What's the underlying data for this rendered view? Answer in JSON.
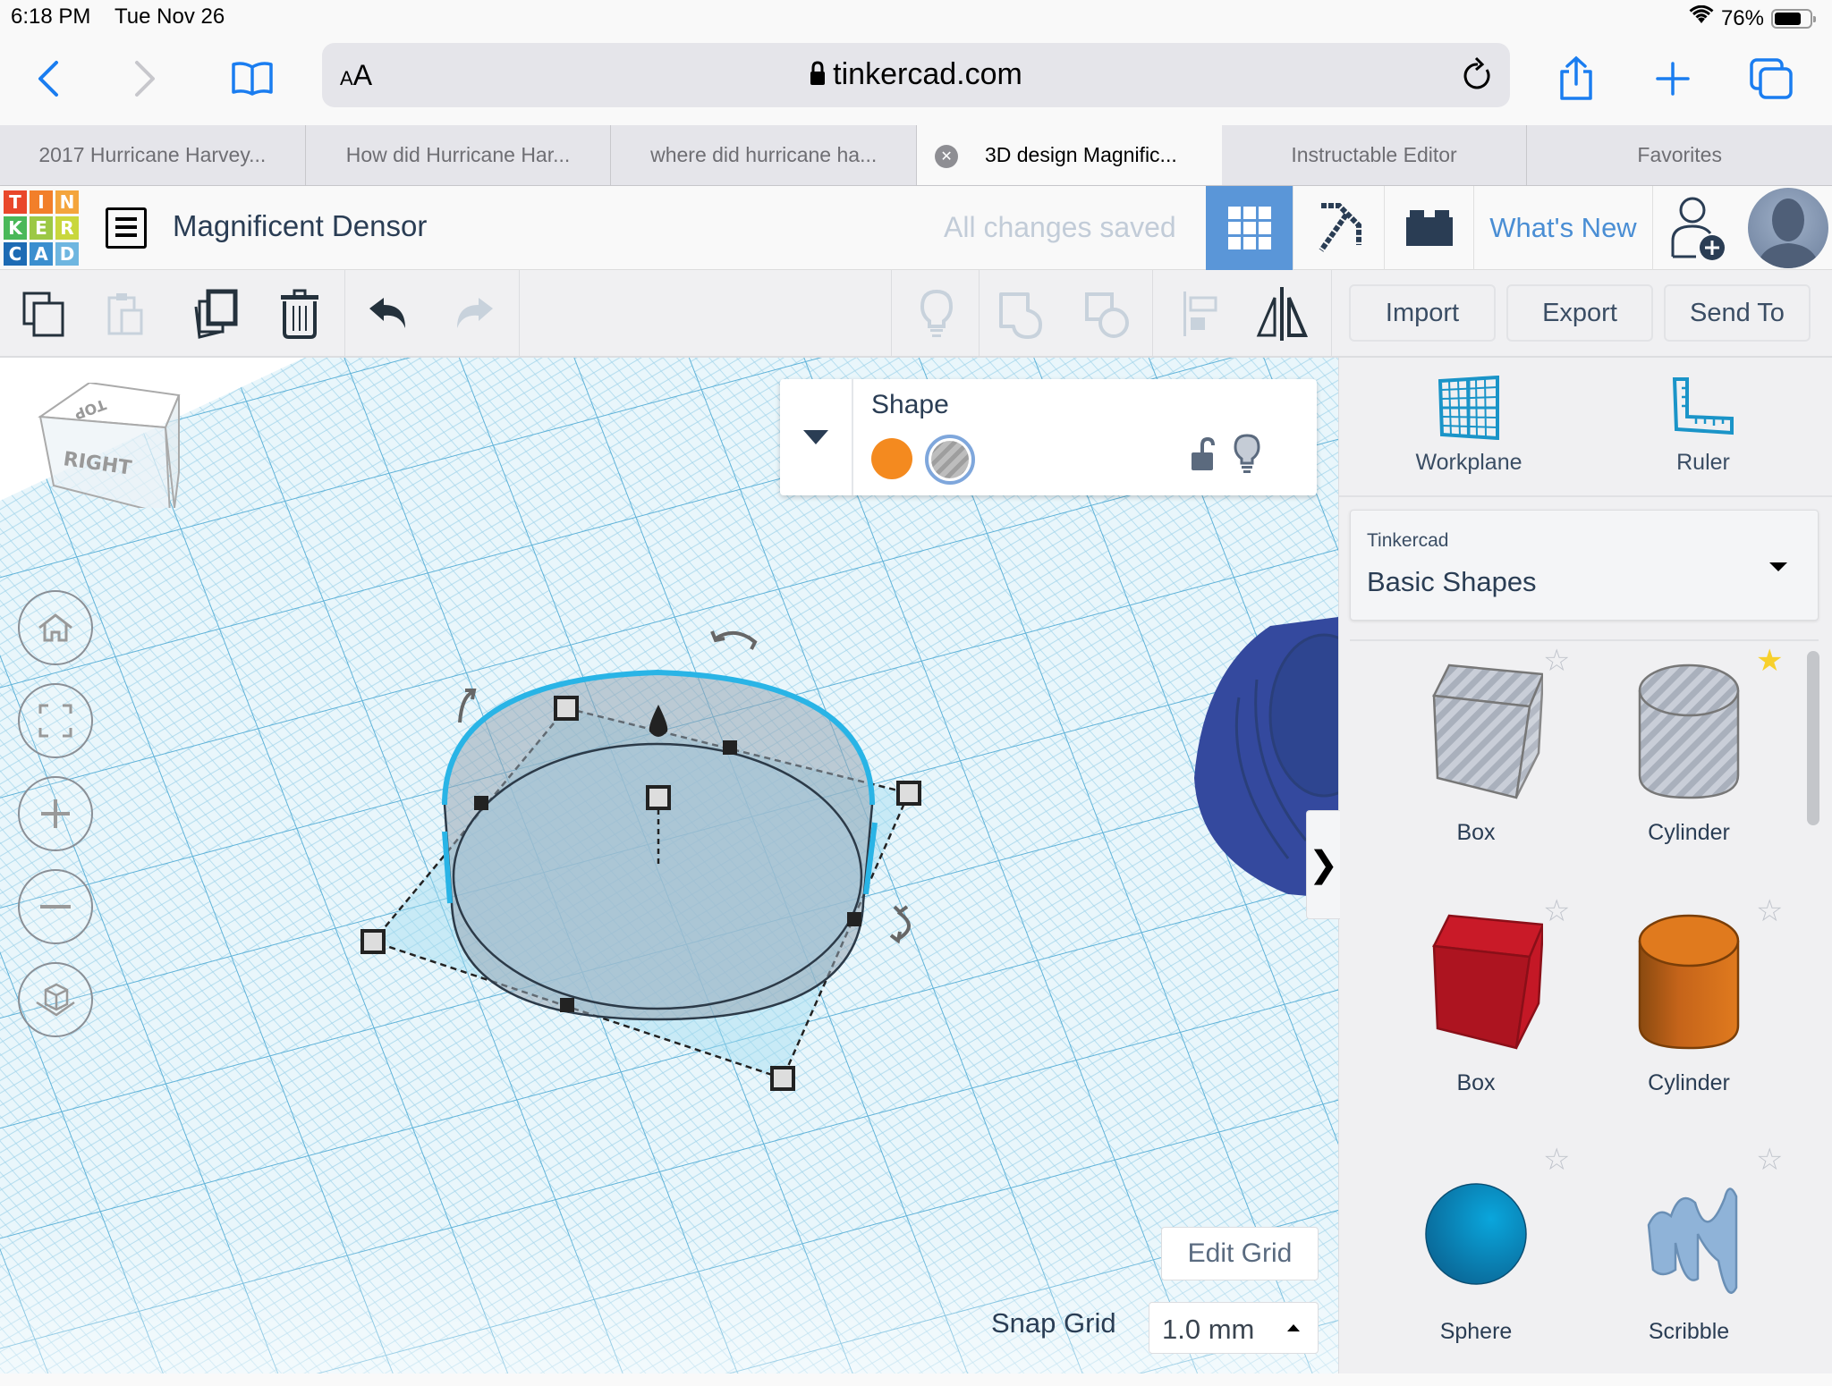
{
  "status_bar": {
    "time": "6:18 PM",
    "date": "Tue Nov 26",
    "battery": "76%",
    "battery_level": 0.76
  },
  "browser": {
    "url": "tinkercad.com",
    "text_size_label": "AA",
    "accent_color": "#1a7df0",
    "tabs": [
      {
        "label": "2017 Hurricane Harvey...",
        "active": false
      },
      {
        "label": "How did Hurricane Har...",
        "active": false
      },
      {
        "label": "where did hurricane ha...",
        "active": false
      },
      {
        "label": "3D design Magnific...",
        "active": true
      },
      {
        "label": "Instructable Editor",
        "active": false
      },
      {
        "label": "Favorites",
        "active": false
      }
    ]
  },
  "app": {
    "logo_letters": [
      "T",
      "I",
      "N",
      "K",
      "E",
      "R",
      "C",
      "A",
      "D"
    ],
    "logo_colors": [
      "#e9472b",
      "#f27f2a",
      "#f4a53c",
      "#4ab859",
      "#9cc845",
      "#c9d73c",
      "#1d6bb4",
      "#3b8fcf",
      "#6eb6e0"
    ],
    "design_title": "Magnificent Densor",
    "save_status": "All changes saved",
    "whats_new": "What's New",
    "active_view_color": "#5a96d8"
  },
  "toolbar": {
    "left": [
      "copy-icon",
      "paste-icon",
      "duplicate-icon",
      "delete-icon",
      "undo-icon",
      "redo-icon"
    ],
    "right": [
      "note-icon",
      "group-icon",
      "ungroup-icon",
      "align-icon",
      "mirror-icon"
    ],
    "import_label": "Import",
    "export_label": "Export",
    "send_to_label": "Send To"
  },
  "viewcube": {
    "top_label": "TOP",
    "right_label": "RIGHT"
  },
  "nav_buttons": [
    "home-view",
    "fit-view",
    "zoom-in",
    "zoom-out",
    "perspective"
  ],
  "inspector": {
    "title": "Shape",
    "solid_color": "#f48a1f",
    "hole_selected": true
  },
  "right_panel": {
    "workplane_label": "Workplane",
    "ruler_label": "Ruler",
    "library_provider": "Tinkercad",
    "library_name": "Basic Shapes",
    "shapes": [
      {
        "label": "Box",
        "kind": "box-hole",
        "favorite": false
      },
      {
        "label": "Cylinder",
        "kind": "cylinder-hole",
        "favorite": true
      },
      {
        "label": "Box",
        "kind": "box-solid",
        "favorite": false
      },
      {
        "label": "Cylinder",
        "kind": "cylinder-solid",
        "favorite": false
      },
      {
        "label": "Sphere",
        "kind": "sphere",
        "favorite": false
      },
      {
        "label": "Scribble",
        "kind": "scribble",
        "favorite": false
      }
    ],
    "collapse_glyph": "❯"
  },
  "grid_controls": {
    "edit_grid_label": "Edit Grid",
    "snap_grid_label": "Snap Grid",
    "snap_value": "1.0 mm"
  }
}
